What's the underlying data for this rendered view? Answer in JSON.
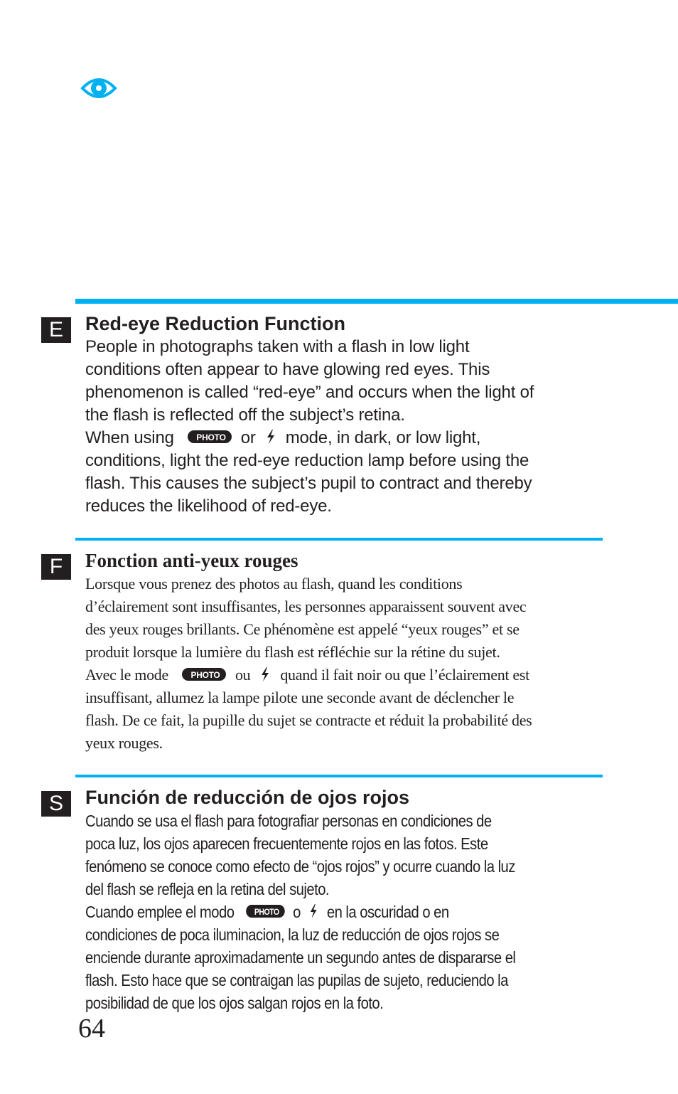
{
  "header": {
    "icon": "eye-icon",
    "accent_color": "#00b0f0"
  },
  "sections": {
    "english": {
      "badge": "E",
      "title": "Red-eye Reduction Function",
      "lines": [
        "People in photographs taken with a flash in low light",
        "conditions often appear to have glowing red eyes. This",
        "phenomenon is called “red-eye” and occurs when the light of",
        "the flash is reflected off the subject’s retina."
      ],
      "mode_line": {
        "before": "When using",
        "between": "or",
        "after": "mode, in dark, or low light,"
      },
      "lines2": [
        "conditions, light the red-eye reduction lamp before using the",
        "flash. This causes the subject’s pupil to contract and thereby",
        "reduces the likelihood of red-eye."
      ]
    },
    "french": {
      "badge": "F",
      "title": "Fonction anti-yeux rouges",
      "lines": [
        "Lorsque vous prenez des photos au flash, quand les conditions",
        "d’éclairement sont insuffisantes, les personnes apparaissent souvent avec",
        "des yeux rouges brillants. Ce phénomène est appelé “yeux rouges” et se",
        "produit lorsque la lumière du flash est réfléchie sur la rétine du sujet."
      ],
      "mode_line": {
        "before": "Avec le mode",
        "between": "ou",
        "after": "quand il fait noir ou que l’éclairement est"
      },
      "lines2": [
        "insuffisant, allumez la lampe pilote une seconde avant de déclencher le",
        "flash. De ce fait, la pupille du sujet se contracte et réduit la probabilité des",
        "yeux rouges."
      ]
    },
    "spanish": {
      "badge": "S",
      "title": "Función de reducción de ojos rojos",
      "lines": [
        "Cuando se usa el flash para fotografiar personas en condiciones de",
        "poca luz, los ojos aparecen frecuentemente rojos en las fotos. Este",
        "fenómeno se conoce como efecto de “ojos rojos” y ocurre cuando la luz",
        "del flash se refleja en la retina del sujeto."
      ],
      "mode_line": {
        "before": "Cuando emplee el modo",
        "between": "o",
        "after": "en la oscuridad o en"
      },
      "lines2": [
        "condiciones de poca iluminacion, la luz de reducción de ojos rojos se",
        "enciende durante aproximadamente un segundo antes de dispararse el",
        "flash. Esto hace que se contraigan las pupilas de sujeto, reduciendo la",
        "posibilidad de que los ojos salgan rojos en la foto."
      ]
    }
  },
  "icons": {
    "photo_mode": "photo-mode-icon",
    "flash": "flash-icon"
  },
  "footer": {
    "page_number": "64"
  }
}
